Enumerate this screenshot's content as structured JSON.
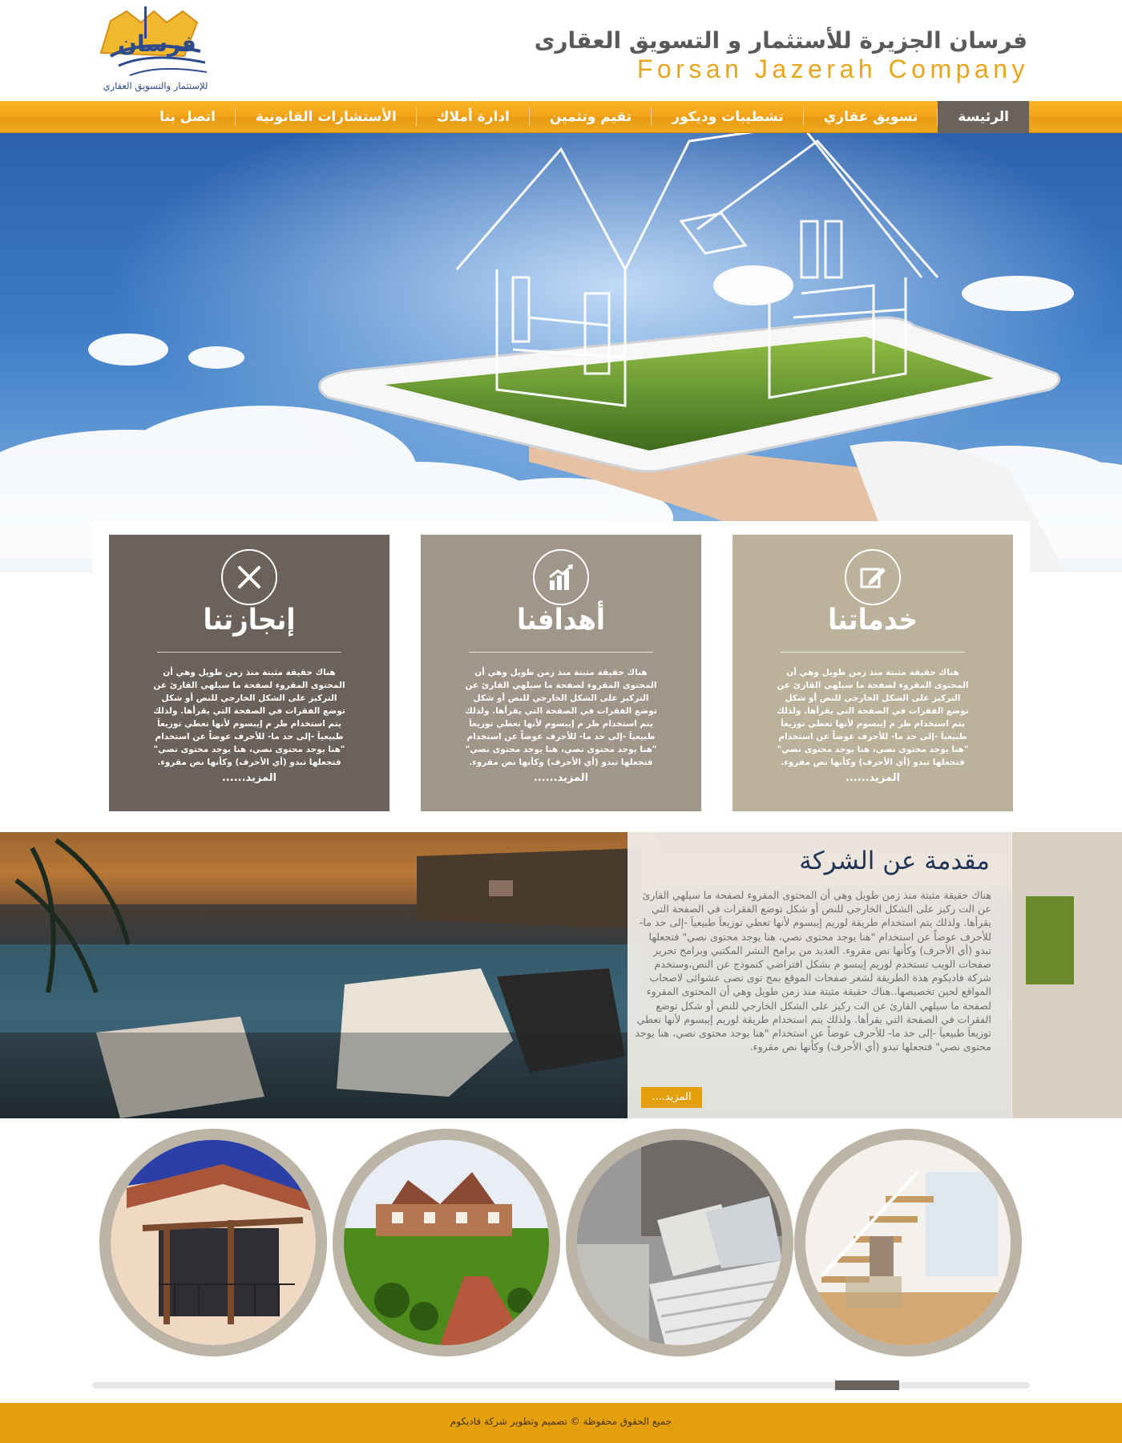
{
  "header": {
    "logo_icon": "forsan-jazeerah-logo",
    "logo_caption": "للإستثمار والتسويق العقاري",
    "company_name_ar": "فرسان الجزيرة للأستثمار و التسويق العقارى",
    "company_name_en": "Forsan Jazerah Company"
  },
  "nav": {
    "items": [
      {
        "label": "الرئيسة",
        "active": true
      },
      {
        "label": "تسويق عقاري",
        "active": false
      },
      {
        "label": "تشطيبات وديكور",
        "active": false
      },
      {
        "label": "تقيم وتثمين",
        "active": false
      },
      {
        "label": "ادارة أملاك",
        "active": false
      },
      {
        "label": "الأستشارات القانونية",
        "active": false
      },
      {
        "label": "اتصل بنا",
        "active": false
      }
    ]
  },
  "hero": {
    "image": "house-wireframe-on-tablet-over-sky"
  },
  "features": [
    {
      "title": "خدماتنا",
      "icon": "edit-pencil-icon",
      "color": "#bcb29c",
      "text": "هناك حقيقة مثبتة منذ زمن طويل وهي أن المحتوى المقروء لصفحة ما سيلهي القارئ عن التركيز على الشكل الخارجي للنص أو شكل توضع الفقرات في الصفحة التي يقرأها. ولذلك يتم استخدام طر م إيبسوم لأنها تعطي توزيعاَ طبيعياَ -إلى حد ما- للأحرف عوضاً عن استخدام \"هنا يوجد محتوى نصي، هنا يوجد محتوى نصي\" فتجعلها تبدو (أي الأحرف) وكأنها نص مقروء.",
      "more": "المزيد......"
    },
    {
      "title": "أهدافنا",
      "icon": "growth-chart-icon",
      "color": "#a0978a",
      "text": "هناك حقيقة مثبتة منذ زمن طويل وهي أن المحتوى المقروء لصفحة ما سيلهي القارئ عن التركيز على الشكل الخارجي للنص أو شكل توضع الفقرات في الصفحة التي يقرأها. ولذلك يتم استخدام طر م إيبسوم لأنها تعطي توزيعاَ طبيعياَ -إلى حد ما- للأحرف عوضاً عن استخدام \"هنا يوجد محتوى نصي، هنا يوجد محتوى نصي\" فتجعلها تبدو (أي الأحرف) وكأنها نص مقروء.",
      "more": "المزيد......"
    },
    {
      "title": "إنجازتنا",
      "icon": "pencil-ruler-icon",
      "color": "#6b625c",
      "text": "هناك حقيقة مثبتة منذ زمن طويل وهي أن المحتوى المقروء لصفحة ما سيلهي القارئ عن التركيز على الشكل الخارجي للنص أو شكل توضع الفقرات في الصفحة التي يقرأها. ولذلك يتم استخدام طر م إيبسوم لأنها تعطي توزيعاَ طبيعياَ -إلى حد ما- للأحرف عوضاً عن استخدام \"هنا يوجد محتوى نصي، هنا يوجد محتوى نصي\" فتجعلها تبدو (أي الأحرف) وكأنها نص مقروء.",
      "more": "المزيد......"
    }
  ],
  "about": {
    "title": "مقدمة عن الشركة",
    "text": "هناك حقيقة مثبتة منذ زمن طويل وهي أن المحتوى المقروء لصفحة ما سيلهي القارئ عن الت ركيز على الشكل الخارجي للنص أو شكل توضع الفقرات في الصفحة التي يقرأها. ولذلك يتم استخدام طريقة لوريم إيبسوم لأنها تعطي توزيعاَ طبيعياَ -إلى حد ما- للأحرف عوضاً عن استخدام \"هنا يوجد محتوى نصي، هنا يوجد محتوى نصي\" فتجعلها تبدو (أي الأحرف) وكأنها نص مقروء. العديد من برامح النشر المكتبي وبرامح تحرير صفحات الويب تستخدم لوريم إيبسو م بشكل افتراضي كنموذج عن النص،وستخدم شركة فاديكوم هذة الطريقة لشغر صفحات الموقع بمج توى نصى عشوائى لاصحاب المواقع لحين تخصيصها..هناك حقيقة مثبتة منذ زمن طويل وهي أن المحتوى المقروء لصفحة ما سيلهي القارئ عن الت ركيز على الشكل الخارجي للنص أو شكل توضع الفقرات في الصفحة التي يقرأها. ولذلك يتم استخدام طريقة لوريم إيبسوم لأنها تعطي توزيعاَ طبيعياَ -إلى حد ما- للأحرف عوضاً عن استخدام \"هنا يوجد محتوى نصي، هنا يوجد محتوى نصي\" فتجعلها تبدو (أي الأحرف) وكأنها نص مقروء.",
    "more": "المزيد....",
    "background_image": "pool-patio-at-sunset"
  },
  "gallery": [
    {
      "image": "villa-balcony-photo"
    },
    {
      "image": "english-manor-garden-photo"
    },
    {
      "image": "bedroom-pillows-photo"
    },
    {
      "image": "wooden-staircase-interior-photo"
    }
  ],
  "slider": {
    "position": 0.85
  },
  "footer": {
    "text": "جميع الحقوق محفوظة  ©  تصميم وتطوير شركة فاديكوم"
  },
  "colors": {
    "accent": "#f4a418",
    "nav_active": "#6b625c",
    "footer": "#e49f0c",
    "title_blue": "#1f3556"
  }
}
